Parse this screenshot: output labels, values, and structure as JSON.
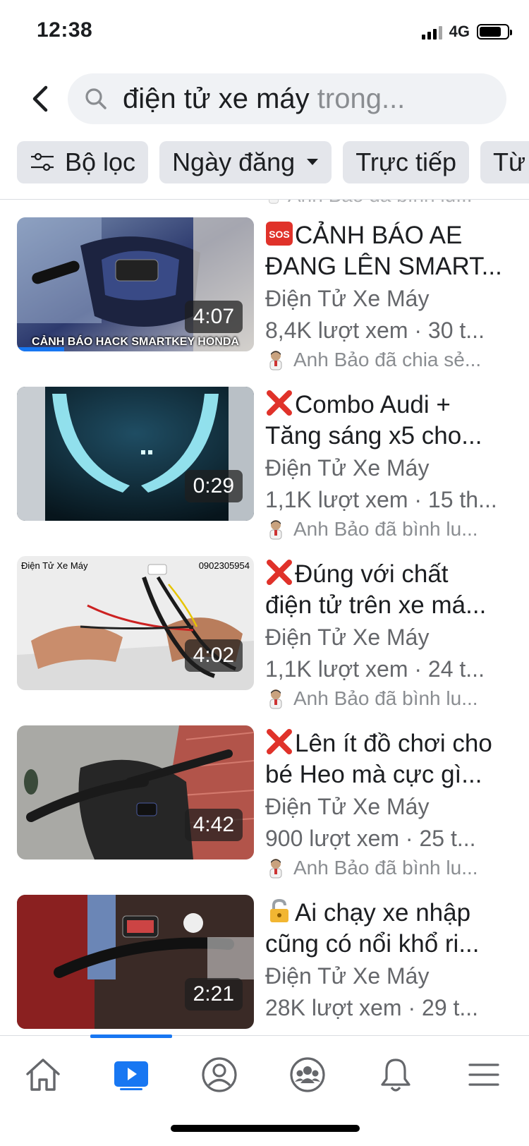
{
  "status": {
    "time": "12:38",
    "network": "4G"
  },
  "search": {
    "query": "điện tử xe máy",
    "hint": " trong..."
  },
  "filters": [
    {
      "label": "Bộ lọc"
    },
    {
      "label": "Ngày đăng"
    },
    {
      "label": "Trực tiếp"
    },
    {
      "label": "Từ"
    }
  ],
  "peek_text": "Anh Bảo đã bình lu...",
  "results": [
    {
      "title_line1": "CẢNH BÁO AE",
      "title_line2": "ĐANG LÊN SMART...",
      "title_emoji": "sos-icon",
      "channel": "Điện Tử Xe Máy",
      "views": "8,4K lượt xem · 30 t...",
      "social": "Anh Bảo đã chia sẻ...",
      "duration": "4:07",
      "thumb_caption": "CẢNH BÁO HACK SMARTKEY HONDA",
      "watched_fraction": 0.2
    },
    {
      "title_line1": "Combo Audi +",
      "title_line2": "Tăng sáng x5 cho...",
      "title_emoji": "cross-mark-icon",
      "channel": "Điện Tử Xe Máy",
      "views": "1,1K lượt xem · 15 th...",
      "social": "Anh Bảo đã bình lu...",
      "duration": "0:29"
    },
    {
      "title_line1": "Đúng với chất",
      "title_line2": "điện tử trên xe má...",
      "title_emoji": "cross-mark-icon",
      "channel": "Điện Tử Xe Máy",
      "views": "1,1K lượt xem · 24 t...",
      "social": "Anh Bảo đã bình lu...",
      "duration": "4:02",
      "thumb_left": "Điện Tử Xe Máy",
      "thumb_right": "0902305954"
    },
    {
      "title_line1": "Lên ít đồ chơi cho",
      "title_line2": "bé Heo mà cực gì...",
      "title_emoji": "cross-mark-icon",
      "channel": "Điện Tử Xe Máy",
      "views": "900 lượt xem · 25 t...",
      "social": "Anh Bảo đã bình lu...",
      "duration": "4:42"
    },
    {
      "title_line1": "Ai chạy xe nhập",
      "title_line2": "cũng có nổi khổ ri...",
      "title_emoji": "lock-icon",
      "channel": "Điện Tử Xe Máy",
      "views": "28K lượt xem · 29 t...",
      "duration": "2:21"
    }
  ],
  "tabs": [
    "home",
    "watch",
    "profile",
    "groups",
    "notifications",
    "menu"
  ],
  "colors": {
    "accent": "#1877f2",
    "chip_bg": "#e4e6eb",
    "search_bg": "#f0f2f5",
    "secondary_text": "#65676b"
  }
}
